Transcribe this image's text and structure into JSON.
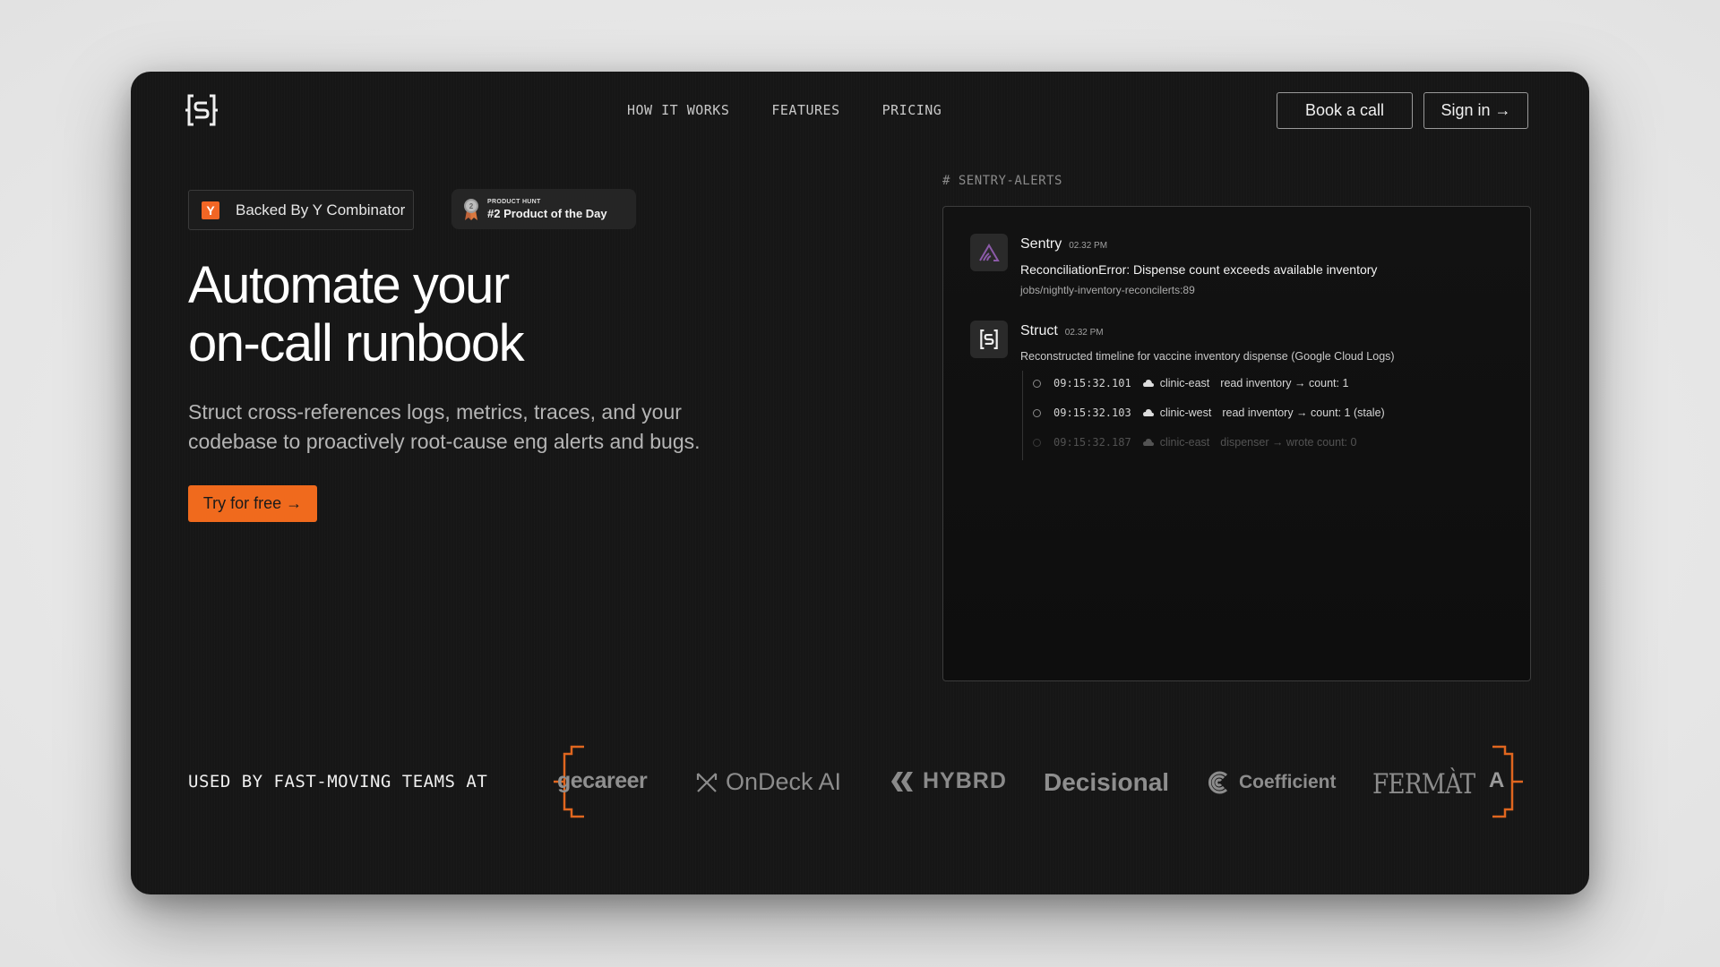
{
  "nav": {
    "links": [
      "HOW IT WORKS",
      "FEATURES",
      "PRICING"
    ],
    "book_label": "Book a call",
    "signin_label": "Sign in →"
  },
  "hero": {
    "yc_letter": "Y",
    "yc_label": "Backed By Y Combinator",
    "ph_small": "PRODUCT HUNT",
    "ph_big": "#2 Product of the Day",
    "title_line1": "Automate your",
    "title_line2": "on-call runbook",
    "subtitle": "Struct cross-references logs, metrics, traces, and your codebase to proactively root-cause eng alerts and bugs.",
    "cta_label": "Try for free →"
  },
  "alerts": {
    "channel": "# SENTRY-ALERTS",
    "sentry": {
      "sender": "Sentry",
      "time": "02.32 PM",
      "error": "ReconciliationError: Dispense count exceeds available inventory",
      "path": "jobs/nightly-inventory-reconcilerts:89"
    },
    "struct": {
      "sender": "Struct",
      "time": "02.32 PM",
      "description": "Reconstructed timeline for vaccine inventory dispense (Google Cloud Logs)",
      "timeline": [
        {
          "ts": "09:15:32.101",
          "host": "clinic-east",
          "action": "read inventory → count: 1"
        },
        {
          "ts": "09:15:32.103",
          "host": "clinic-west",
          "action": "read inventory → count: 1 (stale)"
        },
        {
          "ts": "09:15:32.187",
          "host": "clinic-east",
          "action": "dispenser → wrote count: 0"
        }
      ]
    }
  },
  "customers": {
    "label": "USED BY FAST-MOVING TEAMS AT",
    "logos": [
      "gecareer",
      "OnDeck AI",
      "HYBRD",
      "Decisional",
      "Coefficient",
      "FERMÀT",
      "A"
    ]
  },
  "colors": {
    "accent": "#f06a1d",
    "background": "#161616",
    "sentry_purple": "#7a4fa0"
  }
}
